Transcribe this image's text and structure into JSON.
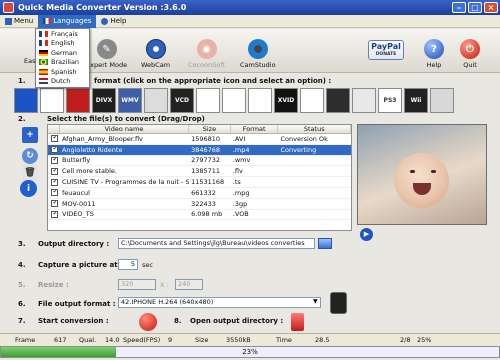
{
  "window": {
    "title": "Quick Media Converter   Version :3.6.0",
    "controls": [
      "–",
      "□",
      "×"
    ]
  },
  "menu": {
    "items": [
      "Menu",
      "Languages",
      "Help"
    ],
    "active": "Languages"
  },
  "languages": [
    {
      "name": "Français",
      "flag": [
        "#1d3f95",
        "#ffffff",
        "#d52b1e"
      ]
    },
    {
      "name": "English",
      "flag": [
        "#1d3f95",
        "#ffffff",
        "#d52b1e"
      ]
    },
    {
      "name": "German",
      "flag": [
        "#000000",
        "#d00000",
        "#ffce00"
      ]
    },
    {
      "name": "Brazilian",
      "flag": [
        "#009c3b",
        "#ffdf00",
        "#009c3b"
      ]
    },
    {
      "name": "Spanish",
      "flag": [
        "#c60b1e",
        "#ffc400",
        "#c60b1e"
      ]
    },
    {
      "name": "Dutch",
      "flag": [
        "#ae1c28",
        "#ffffff",
        "#21468b"
      ]
    }
  ],
  "toolbar": {
    "easy": "Eas",
    "expert": "Expert Mode",
    "webcam": "WebCam",
    "cocoonsoft": "CocoonSoft",
    "camstudio": "CamStudio",
    "paypal": "PayPal",
    "donate": "DONATE",
    "help": "Help",
    "quit": "Quit"
  },
  "steps": {
    "s1": "1.",
    "s1_text": "format (click on the appropriate icon and select an option) :",
    "s2": "2.",
    "s2_text": "Select the file(s) to convert (Drag/Drop)",
    "s3": "3.",
    "s3_text": "Output directory :",
    "s4": "4.",
    "s4_text": "Capture a picture at :",
    "s5": "5.",
    "s5_text": "Resize :",
    "s6": "6.",
    "s6_text": "File output format :",
    "s7": "7.",
    "s7_text": "Start conversion :",
    "s8": "8.",
    "s8_text": "Open output directory :"
  },
  "devices": [
    "",
    "",
    "",
    "DIVX",
    "WMV",
    "",
    "VCD",
    "",
    "",
    "",
    "XVID",
    "",
    "",
    "",
    "PS3",
    "Wii",
    ""
  ],
  "table": {
    "headers": [
      "",
      "Video name",
      "Size",
      "Format",
      "Status"
    ],
    "rows": [
      {
        "name": "Afghan_Army_Blooper.flv",
        "size": "1596810",
        "format": ".AVI",
        "status": "Conversion Ok"
      },
      {
        "name": "Angioletto Ridente",
        "size": "3846768",
        "format": ".mp4",
        "status": "Converting"
      },
      {
        "name": "Butterfly",
        "size": "2797732",
        "format": ".wmv",
        "status": ""
      },
      {
        "name": "Cell more stable.",
        "size": "1385711",
        "format": ".flv",
        "status": ""
      },
      {
        "name": "CUISINE TV - Programmes de la nuit - S",
        "size": "11531168",
        "format": ".ts",
        "status": ""
      },
      {
        "name": "feuaucul",
        "size": "661332",
        "format": ".mpg",
        "status": ""
      },
      {
        "name": "MOV-0011",
        "size": "322433",
        "format": ".3gp",
        "status": ""
      },
      {
        "name": "VIDEO_TS",
        "size": "6.098 mb",
        "format": ".VOB",
        "status": ""
      }
    ]
  },
  "output_dir": "C:\\Documents and Settings\\jlg\\Bureau\\videos converties",
  "capture": {
    "value": "5",
    "unit": "sec"
  },
  "resize": {
    "w": "320",
    "x_label": "X :",
    "h": "240"
  },
  "output_format": "42.IPHONE H.264 (640x480)",
  "status": {
    "frame_label": "Frame",
    "frame": "617",
    "qual_label": "Qual.",
    "qual": "14.0",
    "speed_label": "Speed(FPS)",
    "speed": "9",
    "size_label": "Size",
    "size": "3550kB",
    "time_label": "Time",
    "time": "28.5",
    "pos": "2/8",
    "pct": "25%"
  },
  "progress": {
    "label": "23%",
    "value": 0.23
  }
}
